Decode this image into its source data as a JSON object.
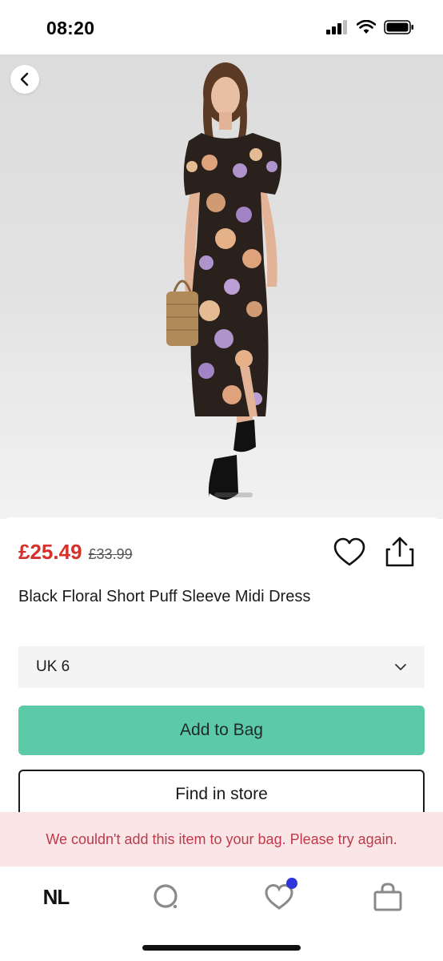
{
  "status_bar": {
    "time": "08:20",
    "icons": [
      "signal-icon",
      "wifi-icon",
      "battery-icon"
    ]
  },
  "hero": {
    "back_icon": "chevron-left-icon",
    "image": "product-photo-floral-midi-dress"
  },
  "product": {
    "price": "£25.49",
    "was_price": "£33.99",
    "title": "Black Floral Short Puff Sleeve Midi Dress",
    "size_value": "UK 6",
    "add_to_bag_label": "Add to Bag",
    "find_in_store_label": "Find in store"
  },
  "error": {
    "message": "We couldn't add this item to your bag. Please try again."
  },
  "bottom_nav": {
    "logo": "NL",
    "items": [
      "home",
      "search",
      "saved",
      "bag"
    ]
  },
  "colors": {
    "price_red": "#d4312b",
    "add_button": "#5cc9a7",
    "error_bg": "#fae6e7",
    "error_text": "#c0384a",
    "badge": "#2f35d9"
  }
}
